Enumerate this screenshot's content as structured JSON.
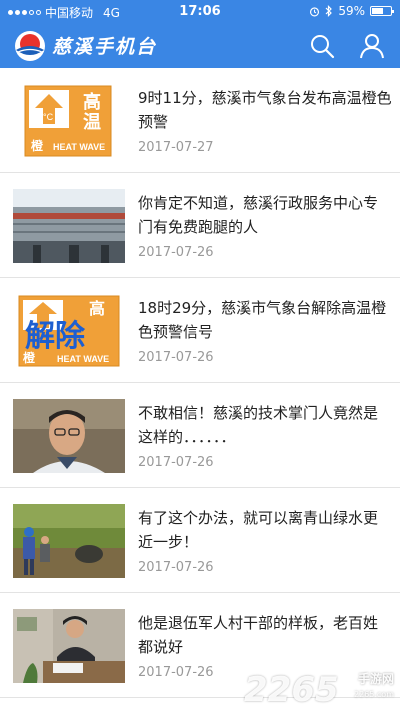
{
  "status_bar": {
    "carrier": "中国移动",
    "network": "4G",
    "time": "17:06",
    "battery": "59%",
    "battery_level": 0.59
  },
  "header": {
    "title": "慈溪手机台",
    "brand_color": "#3a86e4"
  },
  "feed": [
    {
      "title": "9时11分，慈溪市气象台发布高温橙色预警",
      "date": "2017-07-27",
      "thumb": {
        "type": "warning",
        "badge_top": "高",
        "badge_bottom": "温",
        "corner": "橙",
        "label": "HEAT WAVE",
        "temp": "°C"
      }
    },
    {
      "title": "你肯定不知道，慈溪行政服务中心专门有免费跑腿的人",
      "date": "2017-07-26",
      "thumb": {
        "type": "building"
      }
    },
    {
      "title": "18时29分，慈溪市气象台解除高温橙色预警信号",
      "date": "2017-07-26",
      "thumb": {
        "type": "warning-cancel",
        "overlay": "解除",
        "corner": "橙",
        "label": "HEAT WAVE",
        "badge_top": "高"
      }
    },
    {
      "title": "不敢相信！慈溪的技术掌门人竟然是这样的．．．．．．",
      "date": "2017-07-26",
      "thumb": {
        "type": "portrait"
      }
    },
    {
      "title": "有了这个办法，就可以离青山绿水更近一步！",
      "date": "2017-07-26",
      "thumb": {
        "type": "workers"
      }
    },
    {
      "title": "他是退伍军人村干部的样板，老百姓都说好",
      "date": "2017-07-26",
      "thumb": {
        "type": "office"
      }
    }
  ],
  "watermark": {
    "number": "2265",
    "suffix": "手游网",
    "url": "2265.com"
  }
}
